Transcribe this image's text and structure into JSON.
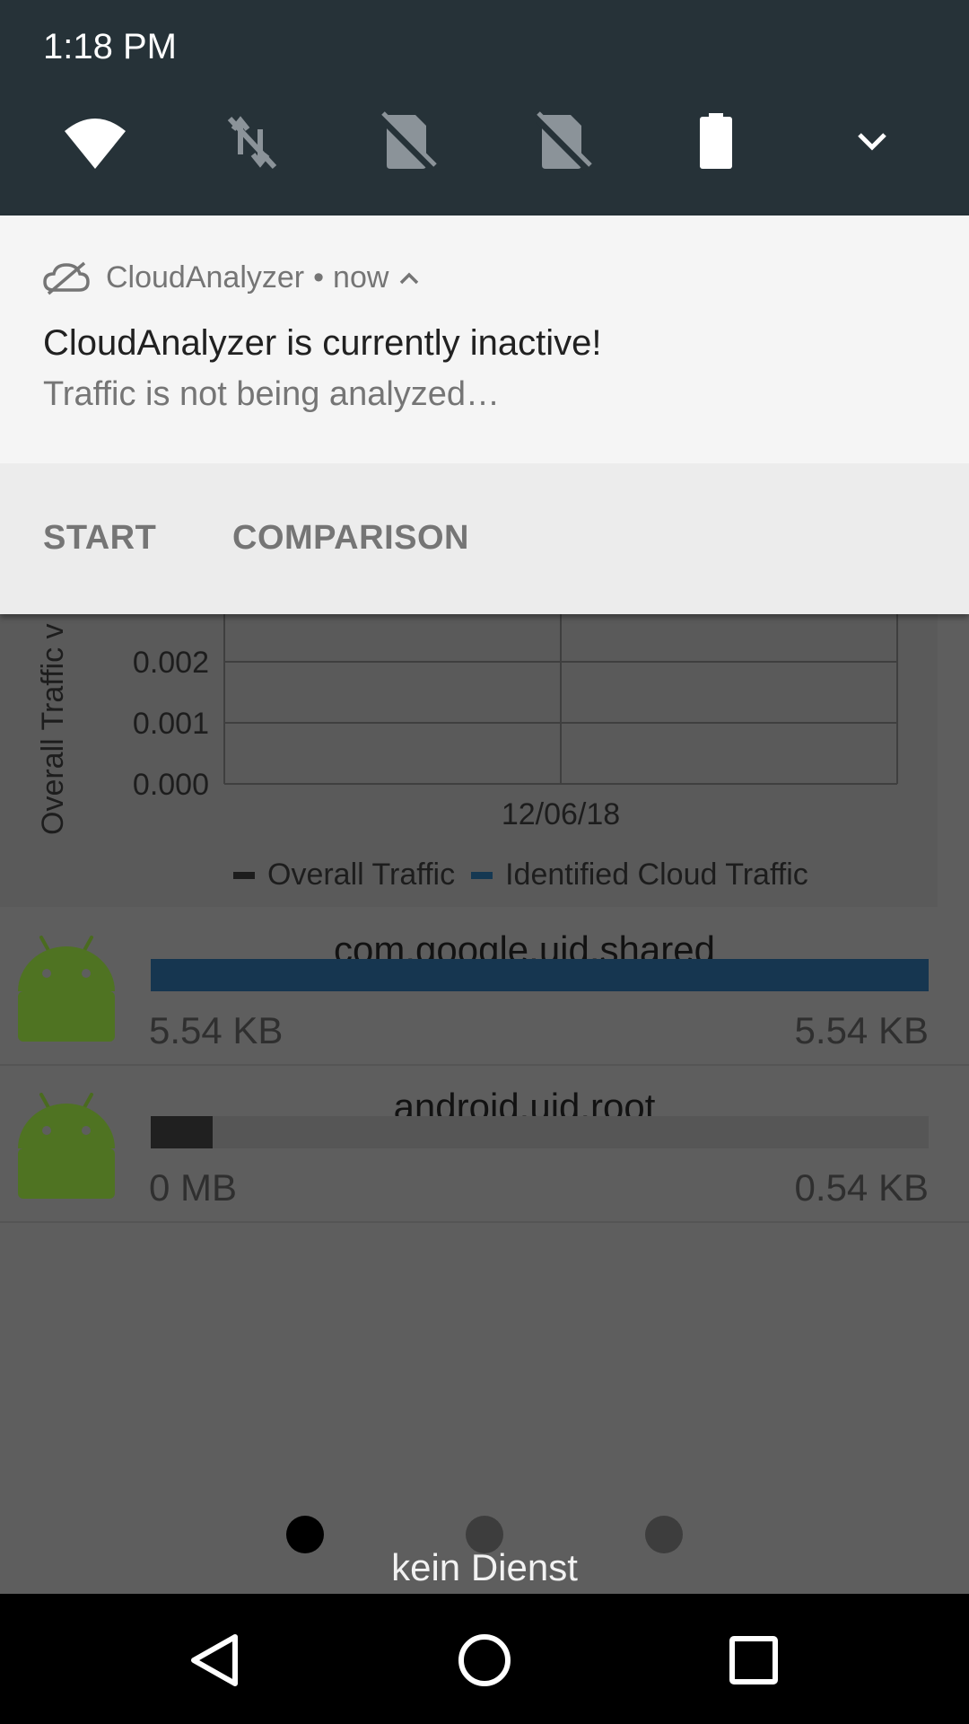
{
  "status_bar": {
    "time": "1:18 PM"
  },
  "quick_settings": {
    "tiles": [
      {
        "icon": "wifi-icon"
      },
      {
        "icon": "mobile-data-off-icon"
      },
      {
        "icon": "sim-card-off-icon"
      },
      {
        "icon": "sim-card-off-icon"
      },
      {
        "icon": "battery-icon"
      }
    ],
    "expand_icon": "chevron-down-icon"
  },
  "notification": {
    "app_name": "CloudAnalyzer",
    "separator": "•",
    "time": "now",
    "title": "CloudAnalyzer is currently inactive!",
    "text": "Traffic is not being analyzed…",
    "actions": {
      "start": "START",
      "comparison": "COMPARISON"
    }
  },
  "chart_data": {
    "type": "line",
    "ylabel": "Overall Traffic v",
    "y_ticks": [
      "0.002",
      "0.001",
      "0.000"
    ],
    "x_ticks": [
      "12/06/18"
    ],
    "series": [
      {
        "name": "Overall Traffic",
        "color": "#1c1c1c"
      },
      {
        "name": "Identified Cloud Traffic",
        "color": "#153852"
      }
    ],
    "grid": true,
    "legend": "bottom"
  },
  "apps": [
    {
      "package": "com.google.uid.shared",
      "used": "5.54 KB",
      "total": "5.54 KB",
      "fraction": 1.0,
      "color": "#163650"
    },
    {
      "package": "android.uid.root",
      "used": "0 MB",
      "total": "0.54 KB",
      "fraction": 0.08,
      "color": "#202020"
    }
  ],
  "page_indicator": {
    "count": 3,
    "active": 0
  },
  "carrier_text": "kein Dienst",
  "nav_bar": {
    "back": "back-icon",
    "home": "home-icon",
    "recents": "recents-icon"
  }
}
